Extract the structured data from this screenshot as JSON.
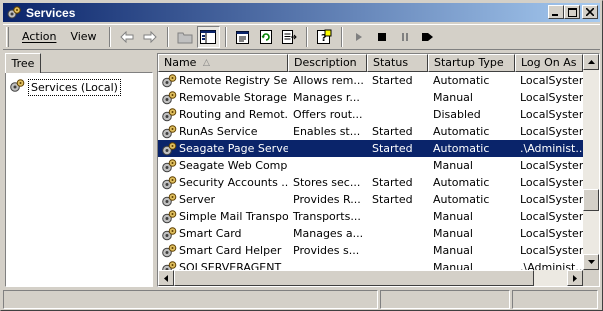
{
  "window": {
    "title": "Services",
    "icon": "gears-icon"
  },
  "title_buttons": {
    "minimize": "_",
    "maximize": "□",
    "close": "✕"
  },
  "menu": {
    "action": "Action",
    "view": "View"
  },
  "toolbar_icons": [
    "back-arrow-icon",
    "forward-arrow-icon",
    "up-folder-icon",
    "show-hide-tree-icon",
    "properties-icon",
    "refresh-icon",
    "export-list-icon",
    "help-icon",
    "start-service-icon",
    "stop-service-icon",
    "pause-service-icon",
    "restart-service-icon"
  ],
  "tree": {
    "tab_label": "Tree",
    "root_label": "Services (Local)"
  },
  "list": {
    "columns": [
      "Name",
      "Description",
      "Status",
      "Startup Type",
      "Log On As"
    ],
    "sort_indicator": "△",
    "rows": [
      {
        "name": "Remote Registry Se...",
        "description": "Allows rem...",
        "status": "Started",
        "startup": "Automatic",
        "logon": "LocalSystem",
        "selected": false
      },
      {
        "name": "Removable Storage",
        "description": "Manages r...",
        "status": "",
        "startup": "Manual",
        "logon": "LocalSystem",
        "selected": false
      },
      {
        "name": "Routing and Remot...",
        "description": "Offers rout...",
        "status": "",
        "startup": "Disabled",
        "logon": "LocalSystem",
        "selected": false
      },
      {
        "name": "RunAs Service",
        "description": "Enables st...",
        "status": "Started",
        "startup": "Automatic",
        "logon": "LocalSystem",
        "selected": false
      },
      {
        "name": "Seagate Page Server",
        "description": "",
        "status": "Started",
        "startup": "Automatic",
        "logon": ".\\Administ...",
        "selected": true
      },
      {
        "name": "Seagate Web Comp...",
        "description": "",
        "status": "",
        "startup": "Manual",
        "logon": "LocalSystem",
        "selected": false
      },
      {
        "name": "Security Accounts ...",
        "description": "Stores sec...",
        "status": "Started",
        "startup": "Automatic",
        "logon": "LocalSystem",
        "selected": false
      },
      {
        "name": "Server",
        "description": "Provides R...",
        "status": "Started",
        "startup": "Automatic",
        "logon": "LocalSystem",
        "selected": false
      },
      {
        "name": "Simple Mail Transpo...",
        "description": "Transports...",
        "status": "",
        "startup": "Manual",
        "logon": "LocalSystem",
        "selected": false
      },
      {
        "name": "Smart Card",
        "description": "Manages a...",
        "status": "",
        "startup": "Manual",
        "logon": "LocalSystem",
        "selected": false
      },
      {
        "name": "Smart Card Helper",
        "description": "Provides s...",
        "status": "",
        "startup": "Manual",
        "logon": "LocalSystem",
        "selected": false
      },
      {
        "name": "SQLSERVERAGENT",
        "description": "",
        "status": "",
        "startup": "Manual",
        "logon": ".\\Administ...",
        "selected": false
      }
    ]
  },
  "colors": {
    "title_start": "#0a246a",
    "title_end": "#a6caf0",
    "selection": "#0a246a",
    "face": "#d4d0c8"
  }
}
